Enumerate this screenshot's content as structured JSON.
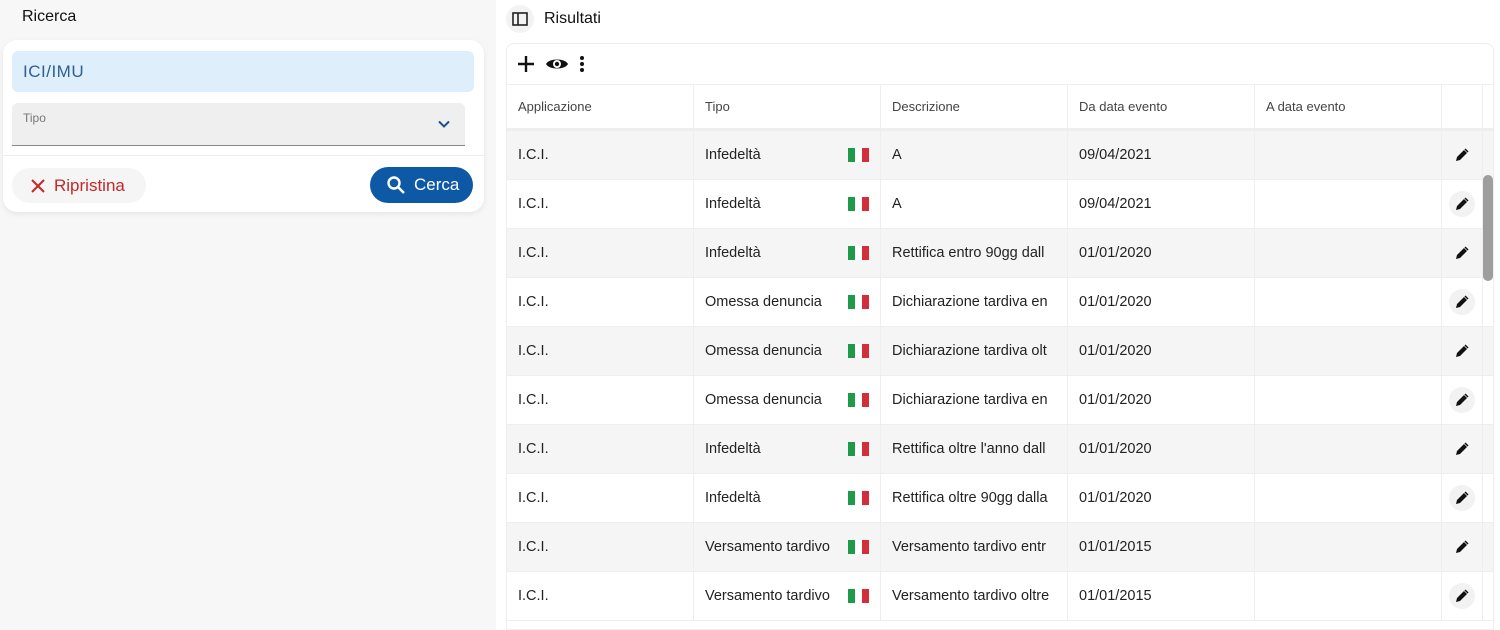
{
  "search": {
    "title": "Ricerca",
    "application_value": "ICI/IMU",
    "tipo_label": "Tipo",
    "reset_label": "Ripristina",
    "search_label": "Cerca"
  },
  "results": {
    "title": "Risultati",
    "columns": [
      "Applicazione",
      "Tipo",
      "Descrizione",
      "Da data evento",
      "A data evento"
    ],
    "rows": [
      {
        "app": "I.C.I.",
        "tipo": "Infedeltà",
        "desc": "A",
        "da": "09/04/2021",
        "a": ""
      },
      {
        "app": "I.C.I.",
        "tipo": "Infedeltà",
        "desc": "A",
        "da": "09/04/2021",
        "a": ""
      },
      {
        "app": "I.C.I.",
        "tipo": "Infedeltà",
        "desc": "Rettifica entro 90gg dall",
        "da": "01/01/2020",
        "a": ""
      },
      {
        "app": "I.C.I.",
        "tipo": "Omessa denuncia",
        "desc": "Dichiarazione tardiva en",
        "da": "01/01/2020",
        "a": ""
      },
      {
        "app": "I.C.I.",
        "tipo": "Omessa denuncia",
        "desc": "Dichiarazione tardiva olt",
        "da": "01/01/2020",
        "a": ""
      },
      {
        "app": "I.C.I.",
        "tipo": "Omessa denuncia",
        "desc": "Dichiarazione tardiva en",
        "da": "01/01/2020",
        "a": ""
      },
      {
        "app": "I.C.I.",
        "tipo": "Infedeltà",
        "desc": "Rettifica oltre l'anno dall",
        "da": "01/01/2020",
        "a": ""
      },
      {
        "app": "I.C.I.",
        "tipo": "Infedeltà",
        "desc": "Rettifica oltre 90gg dalla",
        "da": "01/01/2020",
        "a": ""
      },
      {
        "app": "I.C.I.",
        "tipo": "Versamento tardivo",
        "desc": "Versamento tardivo entr",
        "da": "01/01/2015",
        "a": ""
      },
      {
        "app": "I.C.I.",
        "tipo": "Versamento tardivo",
        "desc": "Versamento tardivo oltre",
        "da": "01/01/2015",
        "a": ""
      }
    ]
  },
  "colors": {
    "primary": "#0d59a6",
    "danger": "#c62828",
    "field_bg": "#dfeefb"
  }
}
